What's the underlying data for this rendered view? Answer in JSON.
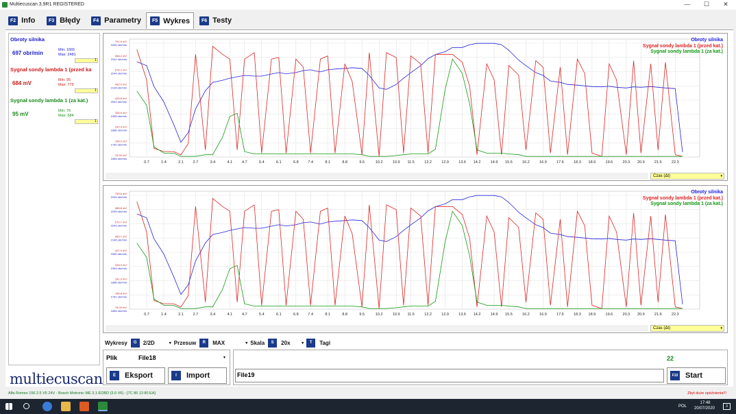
{
  "window": {
    "title": "Multiecuscan 3.9R1 REGISTERED",
    "min": "—",
    "max": "☐",
    "close": "✕"
  },
  "tabs": [
    {
      "key": "F2",
      "label": "Info"
    },
    {
      "key": "F3",
      "label": "Błędy"
    },
    {
      "key": "F4",
      "label": "Parametry"
    },
    {
      "key": "F5",
      "label": "Wykres"
    },
    {
      "key": "F6",
      "label": "Testy"
    }
  ],
  "sensors": [
    {
      "name": "Obroty silnika",
      "value": "697 obr/min",
      "min": "Min: 1665",
      "max": "Max: 2481",
      "color": "#1a1acc",
      "pick": "1"
    },
    {
      "name": "Sygnał sondy lambda 1 (przed ka",
      "value": "684 mV",
      "min": "Min: 95",
      "max": "Max: 779",
      "color": "#cc1a1a",
      "pick": "1"
    },
    {
      "name": "Sygnał sondy lambda 1 (za kat.)",
      "value": "95 mV",
      "min": "Min: 76",
      "max": "Max: 684",
      "color": "#1a8a1a",
      "pick": "1"
    }
  ],
  "legend": [
    {
      "label": "Obroty silnika",
      "color": "#2222dd"
    },
    {
      "label": "Sygnał sondy lambda 1 (przed kat.)",
      "color": "#dd2222"
    },
    {
      "label": "Sygnał sondy lambda 1 (za kat.)",
      "color": "#119911"
    }
  ],
  "chart_data": [
    {
      "type": "line",
      "x": [
        0.3,
        0.7,
        1.0,
        1.4,
        1.8,
        2.1,
        2.4,
        2.7,
        3.1,
        3.4,
        3.8,
        4.1,
        4.4,
        4.7,
        5.1,
        5.4,
        5.8,
        6.1,
        6.4,
        6.8,
        7.1,
        7.4,
        7.8,
        8.1,
        8.4,
        8.8,
        9.1,
        9.5,
        9.8,
        10.2,
        10.5,
        10.9,
        11.2,
        11.5,
        11.9,
        12.2,
        12.5,
        12.9,
        13.2,
        13.6,
        13.9,
        14.2,
        14.6,
        14.9,
        15.2,
        15.5,
        15.9,
        16.2,
        16.6,
        16.9,
        17.2,
        17.6,
        17.9,
        18.3,
        18.6,
        18.9,
        19.3,
        19.6,
        19.9,
        20.3,
        20.6,
        20.9,
        21.3,
        21.6,
        21.9,
        22.3,
        22.6
      ],
      "x_ticks": [
        "0.7",
        "1.4",
        "2.1",
        "2.7",
        "3.4",
        "4.1",
        "4.7",
        "5.4",
        "6.1",
        "6.8",
        "7.4",
        "8.1",
        "8.8",
        "9.5",
        "10.2",
        "10.9",
        "11.5",
        "12.2",
        "12.9",
        "13.6",
        "14.2",
        "14.9",
        "15.5",
        "16.2",
        "16.9",
        "17.6",
        "18.3",
        "18.9",
        "19.6",
        "20.3",
        "20.9",
        "21.6",
        "22.3"
      ],
      "y_ticks_mv": [
        "741.6 mV",
        "668.4 mV",
        "576.2 mV",
        "492.0 mV",
        "409.8 mV",
        "326.6 mV",
        "242.4 mV",
        "159.2 mV",
        "76.00 mV"
      ],
      "y_ticks_rpm": [
        "2439 obr/min",
        "2341 obr/min",
        "2244 obr/min",
        "2128 obr/min",
        "2051 obr/min",
        "1955 obr/min",
        "1856 obr/min",
        "1762 obr/min",
        "1665 obr/min"
      ],
      "xlabel": "Czas (Δt)",
      "series": [
        {
          "name": "Obroty silnika",
          "values": [
            2348,
            2320,
            2170,
            2060,
            1900,
            1770,
            1840,
            2010,
            2140,
            2200,
            2215,
            2230,
            2240,
            2250,
            2245,
            2245,
            2260,
            2270,
            2262,
            2270,
            2285,
            2290,
            2275,
            2290,
            2295,
            2300,
            2305,
            2300,
            2250,
            2160,
            2150,
            2185,
            2230,
            2270,
            2320,
            2370,
            2400,
            2420,
            2450,
            2450,
            2470,
            2480,
            2480,
            2480,
            2470,
            2430,
            2360,
            2320,
            2270,
            2250,
            2210,
            2200,
            2185,
            2180,
            2175,
            2170,
            2168,
            2172,
            2165,
            2160,
            2168,
            2165,
            2170,
            2165,
            2160,
            2155,
            1700
          ]
        },
        {
          "name": "Sygnał sondy lambda 1 (przed kat.)",
          "values": [
            750,
            560,
            130,
            110,
            110,
            90,
            160,
            720,
            120,
            770,
            720,
            690,
            120,
            690,
            730,
            100,
            690,
            700,
            100,
            690,
            640,
            100,
            690,
            710,
            100,
            660,
            550,
            90,
            730,
            80,
            730,
            700,
            100,
            710,
            660,
            100,
            720,
            720,
            720,
            670,
            520,
            90,
            660,
            560,
            90,
            650,
            590,
            120,
            680,
            640,
            100,
            640,
            90,
            690,
            600,
            100,
            80,
            660,
            560,
            90,
            680,
            100,
            660,
            120,
            670,
            90,
            80
          ]
        },
        {
          "name": "Sygnał sondy lambda 1 (za kat.)",
          "values": [
            490,
            400,
            140,
            100,
            100,
            80,
            80,
            80,
            90,
            90,
            200,
            330,
            350,
            110,
            95,
            95,
            95,
            95,
            95,
            95,
            95,
            95,
            95,
            95,
            95,
            95,
            95,
            90,
            80,
            80,
            80,
            85,
            90,
            95,
            95,
            95,
            125,
            500,
            690,
            600,
            410,
            120,
            100,
            100,
            100,
            95,
            90,
            80,
            80,
            80,
            80,
            80,
            80,
            80,
            80,
            80,
            80,
            80,
            80,
            80,
            80,
            80,
            80,
            80,
            80,
            80,
            80
          ]
        }
      ]
    },
    {
      "type": "line",
      "x": [
        0.3,
        0.7,
        1.0,
        1.4,
        1.8,
        2.1,
        2.4,
        2.7,
        3.1,
        3.4,
        3.8,
        4.1,
        4.4,
        4.7,
        5.1,
        5.4,
        5.8,
        6.1,
        6.4,
        6.8,
        7.1,
        7.4,
        7.8,
        8.1,
        8.4,
        8.8,
        9.1,
        9.5,
        9.8,
        10.2,
        10.5,
        10.9,
        11.2,
        11.5,
        11.9,
        12.2,
        12.5,
        12.9,
        13.2,
        13.6,
        13.9,
        14.2,
        14.6,
        14.9,
        15.2,
        15.5,
        15.9,
        16.2,
        16.6,
        16.9,
        17.2,
        17.6,
        17.9,
        18.3,
        18.6,
        18.9,
        19.3,
        19.6,
        19.9,
        20.3,
        20.6,
        20.9,
        21.3,
        21.6,
        21.9,
        22.3,
        22.6
      ],
      "x_ticks": [
        "0.7",
        "1.4",
        "2.1",
        "2.7",
        "3.4",
        "4.1",
        "4.7",
        "5.4",
        "6.1",
        "6.8",
        "7.4",
        "8.1",
        "8.8",
        "9.5",
        "10.2",
        "10.9",
        "11.5",
        "12.2",
        "12.9",
        "13.6",
        "14.2",
        "14.9",
        "15.5",
        "16.2",
        "16.9",
        "17.6",
        "18.3",
        "18.9",
        "19.6",
        "20.3",
        "20.9",
        "21.6",
        "22.3"
      ],
      "y_ticks_mv": [
        "759.6 mV",
        "668.8 mV",
        "570.7 mV",
        "490.7 mV",
        "407.9 mV",
        "333.0 mV",
        "241.9 mV",
        "158.8 mV",
        "76.00 mV"
      ],
      "y_ticks_rpm": [
        "2439 obr/min",
        "2339 obr/min",
        "2243 obr/min",
        "2146 obr/min",
        "2050 obr/min",
        "1954 obr/min",
        "1856 obr/min",
        "1761 obr/min",
        "1665 obr/min"
      ],
      "xlabel": "Czas (Δt)",
      "series": [
        {
          "name": "Obroty silnika",
          "values": [
            2348,
            2320,
            2170,
            2060,
            1900,
            1770,
            1840,
            2010,
            2140,
            2200,
            2215,
            2230,
            2240,
            2250,
            2245,
            2245,
            2260,
            2270,
            2262,
            2270,
            2285,
            2290,
            2275,
            2290,
            2295,
            2300,
            2305,
            2300,
            2250,
            2160,
            2150,
            2185,
            2230,
            2270,
            2320,
            2370,
            2400,
            2420,
            2450,
            2450,
            2470,
            2480,
            2480,
            2480,
            2470,
            2430,
            2360,
            2320,
            2270,
            2250,
            2210,
            2200,
            2185,
            2180,
            2175,
            2170,
            2168,
            2172,
            2165,
            2160,
            2168,
            2165,
            2170,
            2165,
            2160,
            2155,
            1700
          ]
        },
        {
          "name": "Sygnał sondy lambda 1 (przed kat.)",
          "values": [
            750,
            560,
            130,
            110,
            110,
            90,
            160,
            720,
            120,
            770,
            720,
            690,
            120,
            690,
            730,
            100,
            690,
            700,
            100,
            690,
            640,
            100,
            690,
            710,
            100,
            660,
            550,
            90,
            730,
            80,
            730,
            700,
            100,
            710,
            660,
            100,
            720,
            720,
            720,
            670,
            520,
            90,
            660,
            560,
            90,
            650,
            590,
            120,
            680,
            640,
            100,
            640,
            90,
            690,
            600,
            100,
            80,
            660,
            560,
            90,
            680,
            100,
            660,
            120,
            670,
            90,
            80
          ]
        },
        {
          "name": "Sygnał sondy lambda 1 (za kat.)",
          "values": [
            490,
            400,
            140,
            100,
            100,
            80,
            80,
            80,
            90,
            90,
            200,
            330,
            350,
            110,
            95,
            95,
            95,
            95,
            95,
            95,
            95,
            95,
            95,
            95,
            95,
            95,
            95,
            90,
            80,
            80,
            80,
            85,
            90,
            95,
            95,
            95,
            125,
            500,
            690,
            600,
            410,
            120,
            100,
            100,
            100,
            95,
            90,
            80,
            80,
            80,
            80,
            80,
            80,
            80,
            80,
            80,
            80,
            80,
            80,
            80,
            80,
            80,
            80,
            80,
            80,
            80,
            80
          ]
        }
      ]
    }
  ],
  "controls": {
    "wykresy_label": "Wykresy",
    "wykresy_key": "G",
    "wykresy_value": "2/2D",
    "przesuw_label": "Przesuw",
    "przesuw_key": "R",
    "przesuw_value": "MAX",
    "skala_label": "Skala",
    "skala_key": "S",
    "skala_value": "20x",
    "tagi_key": "T",
    "tagi_label": "Tagi",
    "dropdown_arrow": "▾"
  },
  "file_panel": {
    "plik_label": "Plik",
    "plik_value": "File18",
    "eksport_key": "E",
    "eksport_label": "Eksport",
    "import_key": "I",
    "import_label": "Import"
  },
  "record_panel": {
    "count": "22",
    "file_field": "File19",
    "start_key": "F10",
    "start_label": "Start"
  },
  "logo": "multiecuscan",
  "status": {
    "vehicle": "Alfa Romeo 156 2.5 V6 24V - Bosch Motronic ME 3.1 EOBD (3.0 V6) - [7C 86 13 80 EA]",
    "warning": "Zbyt duże opóźnienia!!!"
  },
  "taskbar": {
    "lang": "POL",
    "time": "17:48",
    "date": "20/07/2020",
    "notif": "3"
  }
}
